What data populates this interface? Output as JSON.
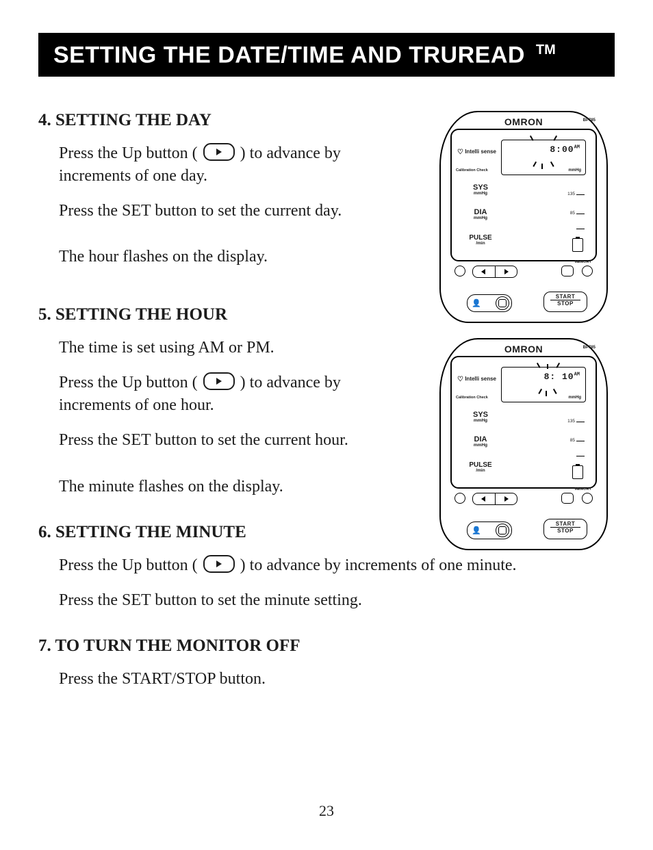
{
  "title": "SETTING THE DATE/TIME AND TRUREAD",
  "title_tm": "TM",
  "page_number": "23",
  "sections": [
    {
      "heading": "4. SETTING THE DAY",
      "p1a": "Press the Up button (",
      "p1b": ") to advance by increments of one day.",
      "p2": "Press the SET button to set the current day.",
      "p3": "The hour flashes on the display."
    },
    {
      "heading": "5. SETTING THE HOUR",
      "p0": "The time is set using AM or PM.",
      "p1a": "Press the Up button (",
      "p1b": ") to advance by increments of one hour.",
      "p2": "Press the SET button to set the current hour.",
      "p3": "The minute flashes on the display."
    },
    {
      "heading": "6. SETTING THE MINUTE",
      "p1a": "Press the Up button (",
      "p1b": ") to advance by increments of one minute.",
      "p2": "Press the SET button to set the minute setting."
    },
    {
      "heading": "7. TO TURN THE MONITOR OFF",
      "p1": "Press the START/STOP button."
    }
  ],
  "device": {
    "brand": "OMRON",
    "model": "BP785",
    "intelli": "Intelli sense",
    "calibration": "Calibration Check",
    "labels": {
      "sys": "SYS",
      "sys_sub": "mmHg",
      "dia": "DIA",
      "dia_sub": "mmHg",
      "pulse": "PULSE",
      "pulse_sub": "/min",
      "memory": "MEMORY",
      "mmhg": "mmHg",
      "tick1": "135",
      "tick2": "85"
    },
    "btn": {
      "start": "START",
      "stop": "STOP"
    },
    "time1": "8:00",
    "time2": "8: 10",
    "ampm": "AM"
  }
}
